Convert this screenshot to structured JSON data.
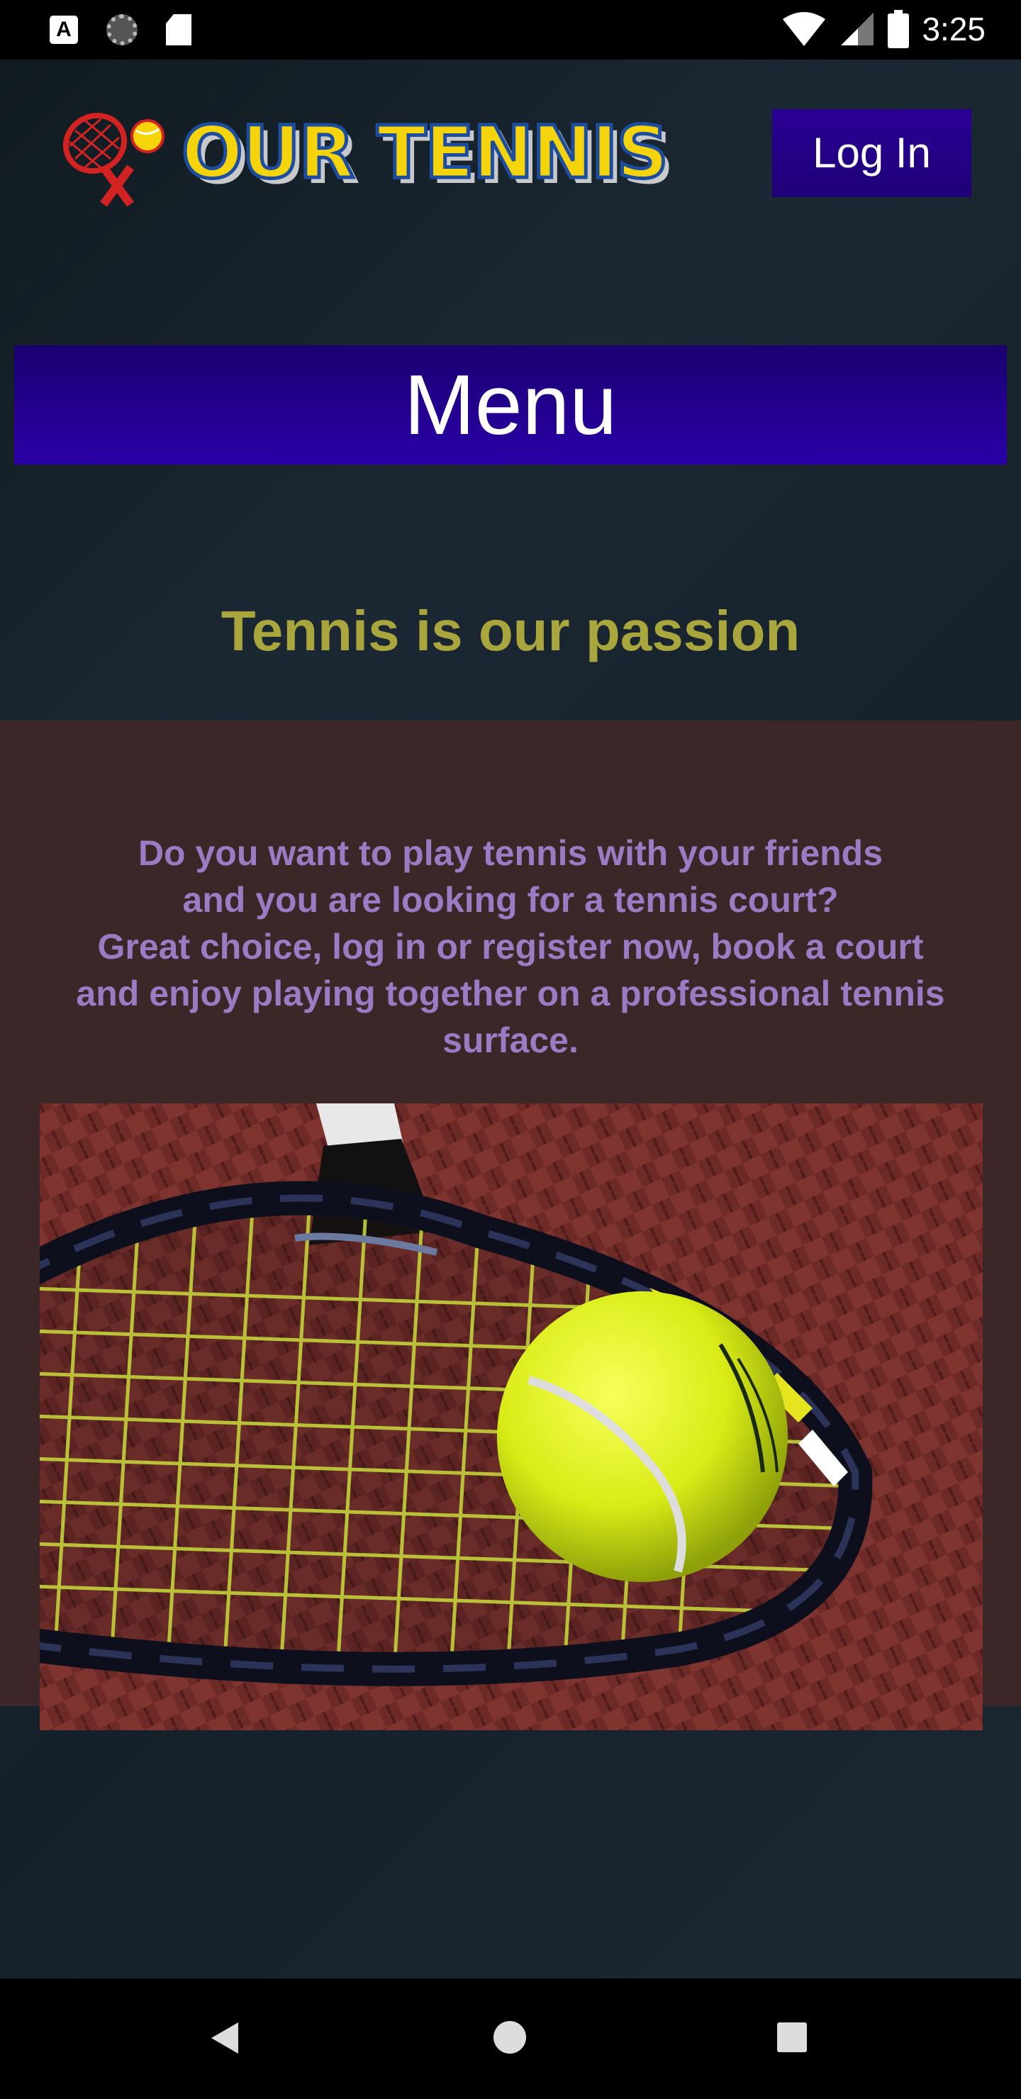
{
  "status_bar": {
    "time": "3:25",
    "app_icon_letter": "A",
    "icons": [
      "text-app-icon",
      "loading-icon",
      "sd-card-icon",
      "wifi-icon",
      "signal-icon",
      "battery-icon"
    ]
  },
  "header": {
    "logo_text": "OUR TENNIS",
    "login_label": "Log In"
  },
  "menu": {
    "label": "Menu"
  },
  "tagline": "Tennis is our passion",
  "promo": {
    "lines": [
      "Do you want to play tennis with your friends",
      "and you are looking for a tennis court?",
      "Great choice, log in or register now, book a court",
      "and enjoy playing together on a professional tennis",
      "surface."
    ],
    "image_subject": "tennis racket with ball on clay court"
  },
  "nav_bar": {
    "icons": [
      "back-icon",
      "home-icon",
      "recents-icon"
    ]
  },
  "colors": {
    "login_button": "#2a0094",
    "menu_bar": "#2a00a8",
    "tagline": "#a8a63c",
    "promo_background": "#3b2628",
    "promo_text": "#9b7cc4",
    "logo_text": "#f5d40c"
  }
}
